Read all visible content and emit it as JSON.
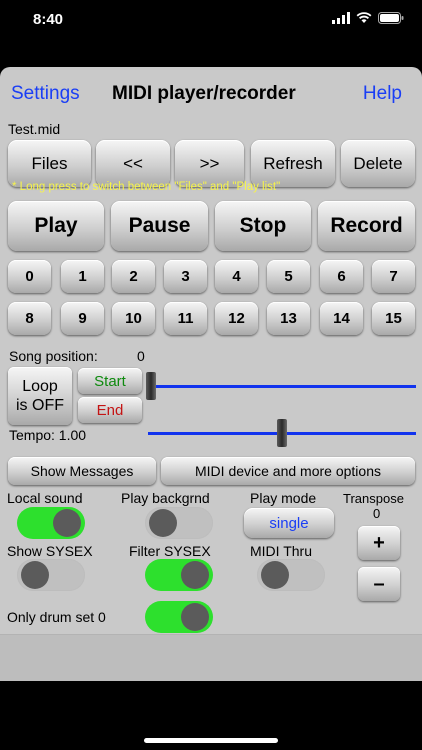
{
  "status_bar": {
    "time": "8:40"
  },
  "nav": {
    "settings": "Settings",
    "title": "MIDI player/recorder",
    "help": "Help"
  },
  "file_name": "Test.mid",
  "file_buttons": {
    "files": "Files",
    "prev": "<<",
    "next": ">>",
    "refresh": "Refresh",
    "delete": "Delete"
  },
  "hint": {
    "star": "*",
    "text": "* Long press to switch between \"Files\" and \"Play list\""
  },
  "transport": {
    "play": "Play",
    "pause": "Pause",
    "stop": "Stop",
    "record": "Record"
  },
  "channels": [
    "0",
    "1",
    "2",
    "3",
    "4",
    "5",
    "6",
    "7",
    "8",
    "9",
    "10",
    "11",
    "12",
    "13",
    "14",
    "15"
  ],
  "song_position": {
    "label": "Song position:",
    "value": "0"
  },
  "loop": {
    "line1": "Loop",
    "line2": "is OFF",
    "start": "Start",
    "end": "End"
  },
  "tempo": {
    "label": "Tempo: 1.00"
  },
  "options": {
    "show_messages": "Show Messages",
    "midi_device": "MIDI device and more options"
  },
  "toggles": {
    "local_sound": {
      "label": "Local sound",
      "state": "on"
    },
    "play_background": {
      "label": "Play backgrnd",
      "state": "off"
    },
    "show_sysex": {
      "label": "Show SYSEX",
      "state": "off"
    },
    "filter_sysex": {
      "label": "Filter SYSEX",
      "state": "on"
    },
    "midi_thru": {
      "label": "MIDI Thru",
      "state": "off"
    },
    "only_drum_set": {
      "label": "Only drum set 0",
      "state": "on"
    }
  },
  "play_mode": {
    "label": "Play mode",
    "value": "single"
  },
  "transpose": {
    "label": "Transpose",
    "value": "0",
    "plus": "+",
    "minus": "–"
  },
  "colors": {
    "accent_blue": "#1a3ef5",
    "toggle_on": "#2de02d",
    "start_green": "#0f8a0f",
    "end_red": "#c41414",
    "hint_yellow": "#f7f54a"
  }
}
